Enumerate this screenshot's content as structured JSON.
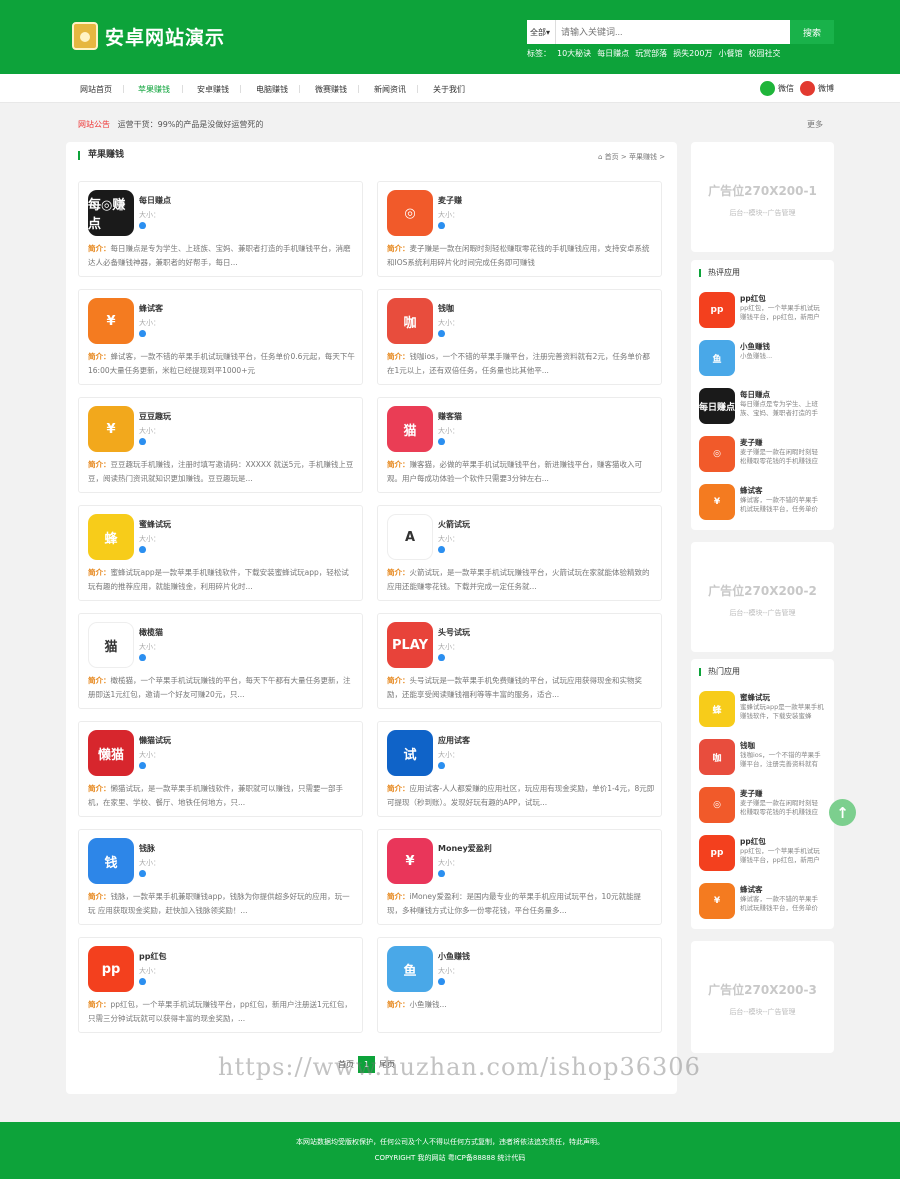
{
  "header": {
    "site_title": "安卓网站演示",
    "search_scope": "全部",
    "search_placeholder": "请输入关键词...",
    "search_button": "搜索",
    "tags_label": "标签：",
    "tags": [
      "10大秘诀",
      "每日赚点",
      "玩赏部落",
      "损失200万",
      "小餐馆",
      "校园社交"
    ]
  },
  "nav": {
    "items": [
      "网站首页",
      "苹果赚钱",
      "安卓赚钱",
      "电脑赚钱",
      "微赛赚钱",
      "新闻资讯",
      "关于我们"
    ],
    "active": "苹果赚钱",
    "wechat": "微信",
    "weibo": "微博"
  },
  "notice": {
    "label": "网站公告",
    "text": "运营干货：99%的产品是没做好运营死的",
    "more": "更多"
  },
  "main": {
    "section_title": "苹果赚钱",
    "breadcrumb": "首页 > 苹果赚钱 >",
    "size_label": "大小：",
    "intro_label": "简介：",
    "apps": [
      {
        "name": "每日赚点",
        "desc": "每日赚点是专为学生、上班族、宝妈、兼职者打造的手机赚钱平台，消磨达人必备赚钱神器，兼职者的好帮手，每日...",
        "icon_text": "每◎赚点",
        "color": "#1a1a1a"
      },
      {
        "name": "麦子赚",
        "desc": "麦子赚是一款在闲暇时刻轻松赚取零花钱的手机赚钱应用，支持安卓系统和IOS系统利用碎片化时间完成任务即可赚钱",
        "icon_text": "◎",
        "color": "#f15a2a"
      },
      {
        "name": "蜂试客",
        "desc": "蜂试客，一款不错的苹果手机试玩赚钱平台，任务单价0.6元起，每天下午16:00大量任务更新，米粒已经提现到平1000+元",
        "icon_text": "¥",
        "color": "#f47b20"
      },
      {
        "name": "钱咖",
        "desc": "钱咖ios，一个不错的苹果手赚平台，注册完善资料就有2元，任务单价都在1元以上，还有双倍任务，任务量也比其他平...",
        "icon_text": "咖",
        "color": "#e84d3d"
      },
      {
        "name": "豆豆趣玩",
        "desc": "豆豆趣玩手机赚钱，注册时填写邀请码：XXXXX 就送5元，手机赚钱上豆豆，阅读热门资讯就知识更加赚钱。豆豆趣玩是...",
        "icon_text": "¥",
        "color": "#f2a81c"
      },
      {
        "name": "赚客猫",
        "desc": "赚客猫，必做的苹果手机试玩赚钱平台，新进赚钱平台，赚客猫收入可观。用户每成功体验一个软件只需要3分钟左右...",
        "icon_text": "猫",
        "color": "#ea3d55"
      },
      {
        "name": "蜜蜂试玩",
        "desc": "蜜蜂试玩app是一款苹果手机赚钱软件，下载安装蜜蜂试玩app，轻松试玩有趣的推荐应用，就能赚钱金，利用碎片化时...",
        "icon_text": "蜂",
        "color": "#f7cc1a"
      },
      {
        "name": "火箭试玩",
        "desc": "火箭试玩，是一款苹果手机试玩赚钱平台，火箭试玩在家就能体验精致的应用还能赚零花钱。下载并完成一定任务就...",
        "icon_text": "A",
        "color": "#ffffff"
      },
      {
        "name": "橄榄猫",
        "desc": "橄榄猫，一个苹果手机试玩赚钱的平台，每天下午都有大量任务更新，注册即送1元红包，邀请一个好友可赚20元，只...",
        "icon_text": "猫",
        "color": "#ffffff"
      },
      {
        "name": "头号试玩",
        "desc": "头号试玩是一款苹果手机免费赚钱的平台，试玩应用获得现金和实物奖励，还能享受阅读赚钱福利等等丰富的服务，适合...",
        "icon_text": "PLAY",
        "color": "#e8433a"
      },
      {
        "name": "懒猫试玩",
        "desc": "懒猫试玩，是一款苹果手机赚钱软件，兼职就可以赚钱，只需要一部手机，在家里、学校、餐厅、地铁任何地方，只...",
        "icon_text": "懒猫",
        "color": "#d7262d"
      },
      {
        "name": "应用试客",
        "desc": "应用试客-人人都爱赚的应用社区，玩应用有现金奖励，单价1-4元，8元即可提现（秒到账）。发现好玩有趣的APP，试玩...",
        "icon_text": "试",
        "color": "#0f63c8"
      },
      {
        "name": "钱脉",
        "desc": "钱脉，一款苹果手机兼职赚钱app，钱脉为你提供超多好玩的应用，玩一玩 应用获取现金奖励，赶快加入钱脉领奖励！...",
        "icon_text": "钱",
        "color": "#2d86e8"
      },
      {
        "name": "Money爱盈利",
        "desc": "iMoney爱盈利：是国内最专业的苹果手机应用试玩平台，10元就能提现，多种赚钱方式让你多一份零花钱，平台任务量多...",
        "icon_text": "¥",
        "color": "#e9365a"
      },
      {
        "name": "pp红包",
        "desc": "pp红包，一个苹果手机试玩赚钱平台，pp红包，新用户注册送1元红包，只需三分钟试玩就可以获得丰富的现金奖励，...",
        "icon_text": "pp",
        "color": "#f3401e"
      },
      {
        "name": "小鱼赚钱",
        "desc": "小鱼赚钱...",
        "icon_text": "鱼",
        "color": "#49a8e8"
      }
    ],
    "pager": {
      "prev": "首页",
      "current": "1",
      "next": "尾页"
    }
  },
  "sidebar": {
    "ads": [
      {
        "title": "广告位270X200-1",
        "sub": "后台--模块--广告管理"
      },
      {
        "title": "广告位270X200-2",
        "sub": "后台--模块--广告管理"
      },
      {
        "title": "广告位270X200-3",
        "sub": "后台--模块--广告管理"
      }
    ],
    "hot_comments": {
      "title": "热评应用",
      "items": [
        {
          "name": "pp红包",
          "desc": "pp红包，一个苹果手机试玩赚钱平台，pp红包，新用户",
          "icon_text": "pp",
          "color": "#f3401e"
        },
        {
          "name": "小鱼赚钱",
          "desc": "小鱼赚钱...",
          "icon_text": "鱼",
          "color": "#49a8e8"
        },
        {
          "name": "每日赚点",
          "desc": "每日赚点是专为学生、上班族、宝妈、兼职者打造的手",
          "icon_text": "每日赚点",
          "color": "#1a1a1a"
        },
        {
          "name": "麦子赚",
          "desc": "麦子赚是一款在闲暇时刻轻松赚取零花钱的手机赚钱应",
          "icon_text": "◎",
          "color": "#f15a2a"
        },
        {
          "name": "蜂试客",
          "desc": "蜂试客，一款不错的苹果手机试玩赚钱平台，任务单价",
          "icon_text": "¥",
          "color": "#f47b20"
        }
      ]
    },
    "hot_apps": {
      "title": "热门应用",
      "items": [
        {
          "name": "蜜蜂试玩",
          "desc": "蜜蜂试玩app是一款苹果手机赚钱软件，下载安装蜜蜂",
          "icon_text": "蜂",
          "color": "#f7cc1a"
        },
        {
          "name": "钱咖",
          "desc": "钱咖ios，一个不错的苹果手赚平台，注册完善资料就有",
          "icon_text": "咖",
          "color": "#e84d3d"
        },
        {
          "name": "麦子赚",
          "desc": "麦子赚是一款在闲暇时刻轻松赚取零花钱的手机赚钱应",
          "icon_text": "◎",
          "color": "#f15a2a"
        },
        {
          "name": "pp红包",
          "desc": "pp红包，一个苹果手机试玩赚钱平台，pp红包，新用户",
          "icon_text": "pp",
          "color": "#f3401e"
        },
        {
          "name": "蜂试客",
          "desc": "蜂试客，一款不错的苹果手机试玩赚钱平台，任务单价",
          "icon_text": "¥",
          "color": "#f47b20"
        }
      ]
    }
  },
  "watermark": "https://www.huzhan.com/ishop36306",
  "footer": {
    "line1": "本网站数据均受版权保护，任何公司及个人不得以任何方式复制，违者将依法追究责任，特此声明。",
    "line2": "COPYRIGHT 我的网站 粤ICP备88888 统计代码"
  },
  "colors": {
    "brand": "#0da33a",
    "intro_label": "#e6861a",
    "notice_label": "#e33"
  }
}
